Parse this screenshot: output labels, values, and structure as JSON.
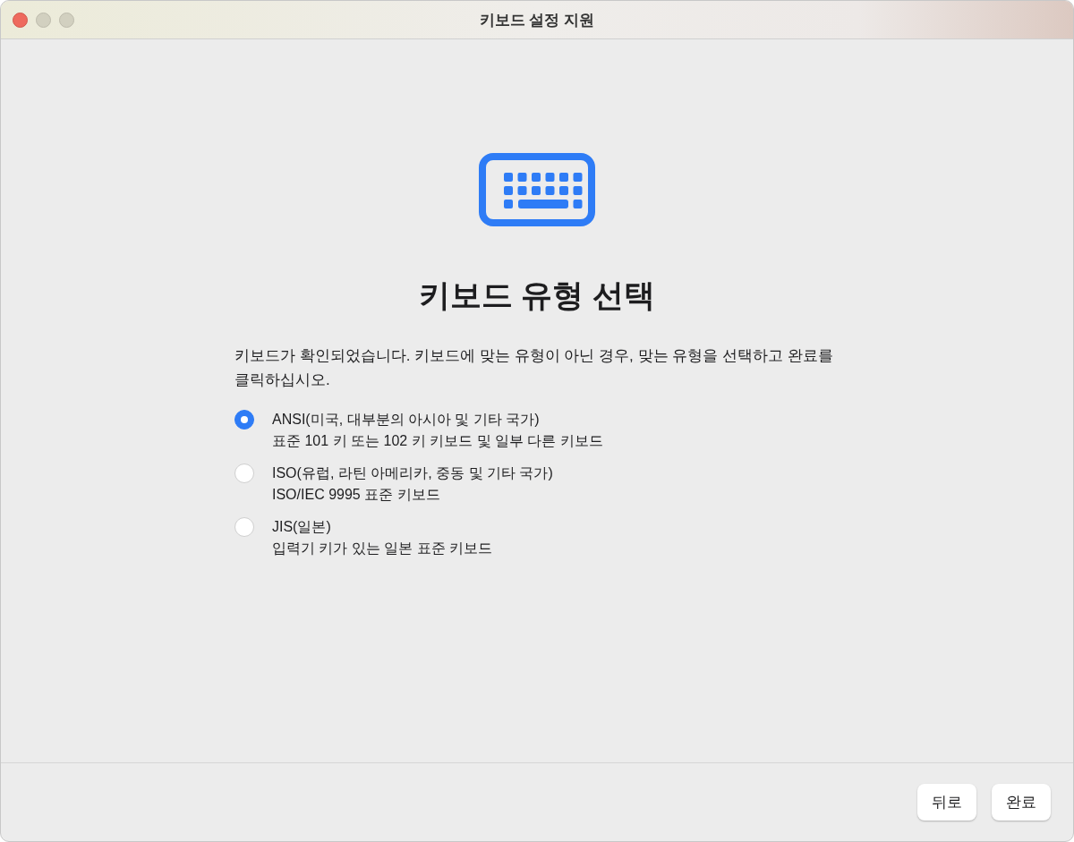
{
  "window": {
    "title": "키보드 설정 지원"
  },
  "heading": "키보드 유형 선택",
  "description": "키보드가 확인되었습니다. 키보드에 맞는 유형이 아닌 경우, 맞는 유형을 선택하고 완료를 클릭하십시오.",
  "options": [
    {
      "label": "ANSI(미국, 대부분의 아시아 및 기타 국가)",
      "detail": "표준 101 키 또는 102 키 키보드 및 일부 다른 키보드",
      "selected": true
    },
    {
      "label": "ISO(유럽, 라틴 아메리카, 중동 및 기타 국가)",
      "detail": "ISO/IEC 9995 표준 키보드",
      "selected": false
    },
    {
      "label": "JIS(일본)",
      "detail": "입력기 키가 있는 일본 표준 키보드",
      "selected": false
    }
  ],
  "buttons": [
    "뒤로",
    "완료"
  ]
}
